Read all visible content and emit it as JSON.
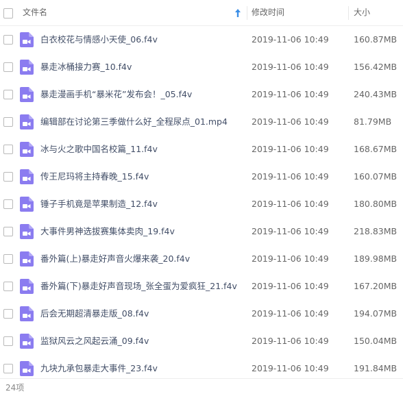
{
  "header": {
    "name_label": "文件名",
    "time_label": "修改时间",
    "size_label": "大小"
  },
  "files": [
    {
      "name": "白衣校花与情感小天使_06.f4v",
      "modified": "2019-11-06 10:49",
      "size": "160.87MB"
    },
    {
      "name": "暴走冰桶接力赛_10.f4v",
      "modified": "2019-11-06 10:49",
      "size": "156.42MB"
    },
    {
      "name": "暴走漫画手机“暴米花”发布会！_05.f4v",
      "modified": "2019-11-06 10:49",
      "size": "240.43MB"
    },
    {
      "name": "编辑部在讨论第三季做什么好_全程尿点_01.mp4",
      "modified": "2019-11-06 10:49",
      "size": "81.79MB"
    },
    {
      "name": "冰与火之歌中国名校篇_11.f4v",
      "modified": "2019-11-06 10:49",
      "size": "168.67MB"
    },
    {
      "name": "传王尼玛将主持春晚_15.f4v",
      "modified": "2019-11-06 10:49",
      "size": "160.07MB"
    },
    {
      "name": "锤子手机竟是苹果制造_12.f4v",
      "modified": "2019-11-06 10:49",
      "size": "180.80MB"
    },
    {
      "name": "大事件男神选拔赛集体卖肉_19.f4v",
      "modified": "2019-11-06 10:49",
      "size": "218.83MB"
    },
    {
      "name": "番外篇(上)暴走好声音火爆来袭_20.f4v",
      "modified": "2019-11-06 10:49",
      "size": "189.98MB"
    },
    {
      "name": "番外篇(下)暴走好声音现场_张全蛋为爱疯狂_21.f4v",
      "modified": "2019-11-06 10:49",
      "size": "167.20MB"
    },
    {
      "name": "后会无期超清暴走版_08.f4v",
      "modified": "2019-11-06 10:49",
      "size": "194.07MB"
    },
    {
      "name": "监狱风云之风起云涌_09.f4v",
      "modified": "2019-11-06 10:49",
      "size": "150.04MB"
    },
    {
      "name": "九块九承包暴走大事件_23.f4v",
      "modified": "2019-11-06 10:49",
      "size": "191.84MB"
    }
  ],
  "footer": {
    "count_label": "24项"
  },
  "icons": {
    "file_type": "video-file-icon",
    "sort": "sort-ascending-arrow-icon"
  },
  "colors": {
    "video_icon": "#8b7cf0",
    "sort_arrow": "#3a8ee6",
    "filename_text": "#424e67"
  }
}
